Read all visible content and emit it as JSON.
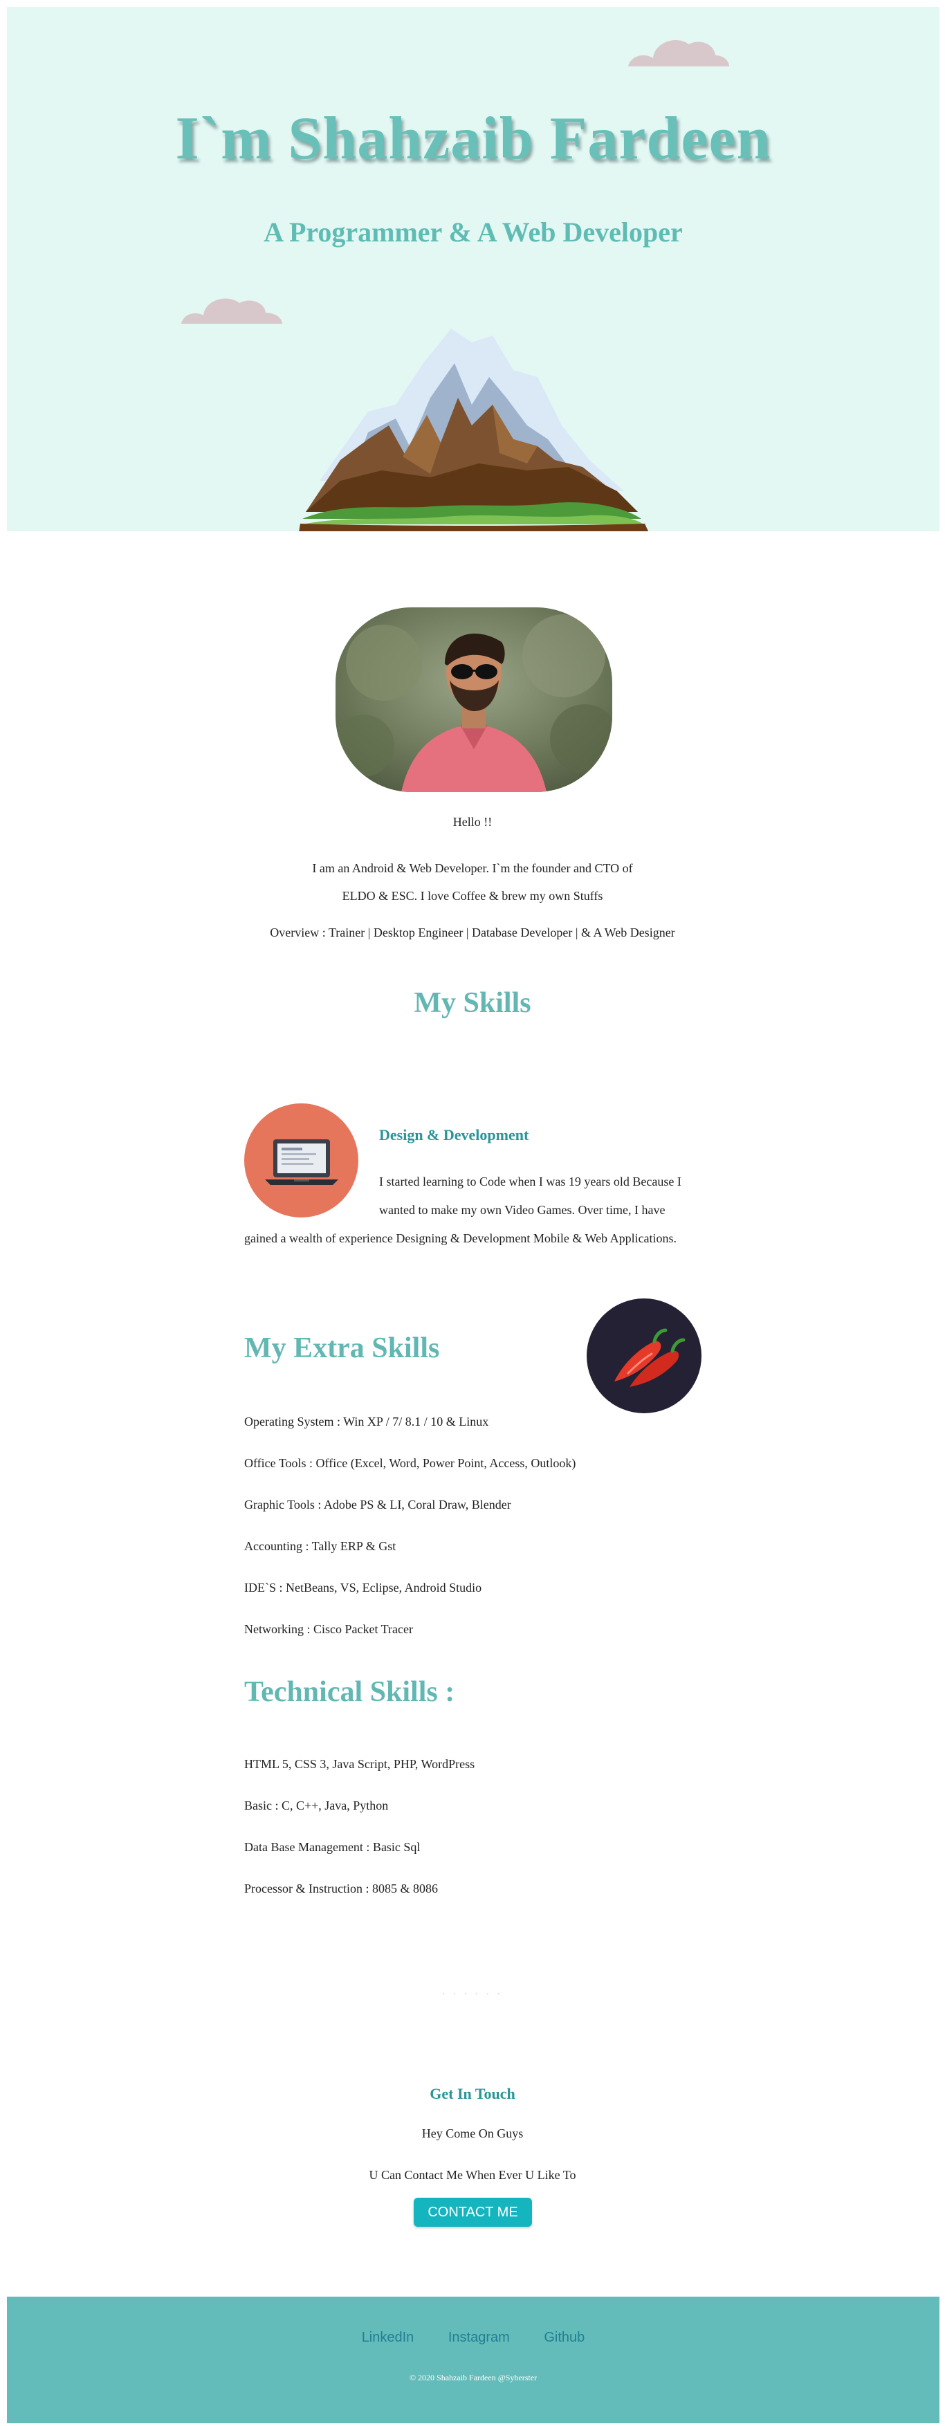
{
  "hero": {
    "title": "I`m Shahzaib Fardeen",
    "subtitle": "A Programmer & A Web Developer"
  },
  "about": {
    "hello": "Hello !!",
    "bio_line1": "I am an Android & Web Developer. I`m the founder and CTO of",
    "bio_line2": "ELDO & ESC. I love Coffee & brew my own Stuffs",
    "overview": "Overview : Trainer | Desktop Engineer | Database Developer | & A Web Designer"
  },
  "skills": {
    "heading": "My Skills",
    "design_title": "Design & Development",
    "design_text": "I started learning to Code when I was 19 years old Because I wanted to make my own Video Games. Over time, I have gained a wealth of experience Designing & Development Mobile & Web Applications."
  },
  "extra_skills": {
    "heading": "My Extra Skills",
    "items": [
      "Operating System : Win XP / 7/ 8.1 / 10 & Linux",
      "Office Tools : Office (Excel, Word, Power Point, Access, Outlook)",
      "Graphic Tools : Adobe PS & LI, Coral Draw, Blender",
      "Accounting : Tally ERP & Gst",
      "IDE`S : NetBeans, VS, Eclipse, Android Studio",
      "Networking : Cisco Packet Tracer"
    ]
  },
  "technical_skills": {
    "heading": "Technical Skills :",
    "items": [
      "HTML 5, CSS 3, Java Script, PHP, WordPress",
      "Basic : C, C++, Java, Python",
      "Data Base Management : Basic Sql",
      "Processor & Instruction : 8085 & 8086"
    ]
  },
  "divider": ". . . . . .",
  "get_in_touch": {
    "heading": "Get In Touch",
    "line1": "Hey Come On Guys",
    "line2": "U Can Contact Me When Ever U Like To",
    "button": "CONTACT ME"
  },
  "footer": {
    "links": [
      "LinkedIn",
      "Instagram",
      "Github"
    ],
    "copyright": "© 2020 Shahzaib Fardeen @Syberster"
  },
  "colors": {
    "hero_bg": "#e3f7f3",
    "accent_teal": "#62b7b3",
    "heading_teal": "#2a9498",
    "button": "#15b5bf",
    "footer_bg": "#64bcba",
    "design_circle": "#e5765c",
    "chili_circle": "#232133"
  },
  "icons": [
    "cloud-icon",
    "mountain-illustration",
    "laptop-icon",
    "chili-pepper-icon"
  ]
}
